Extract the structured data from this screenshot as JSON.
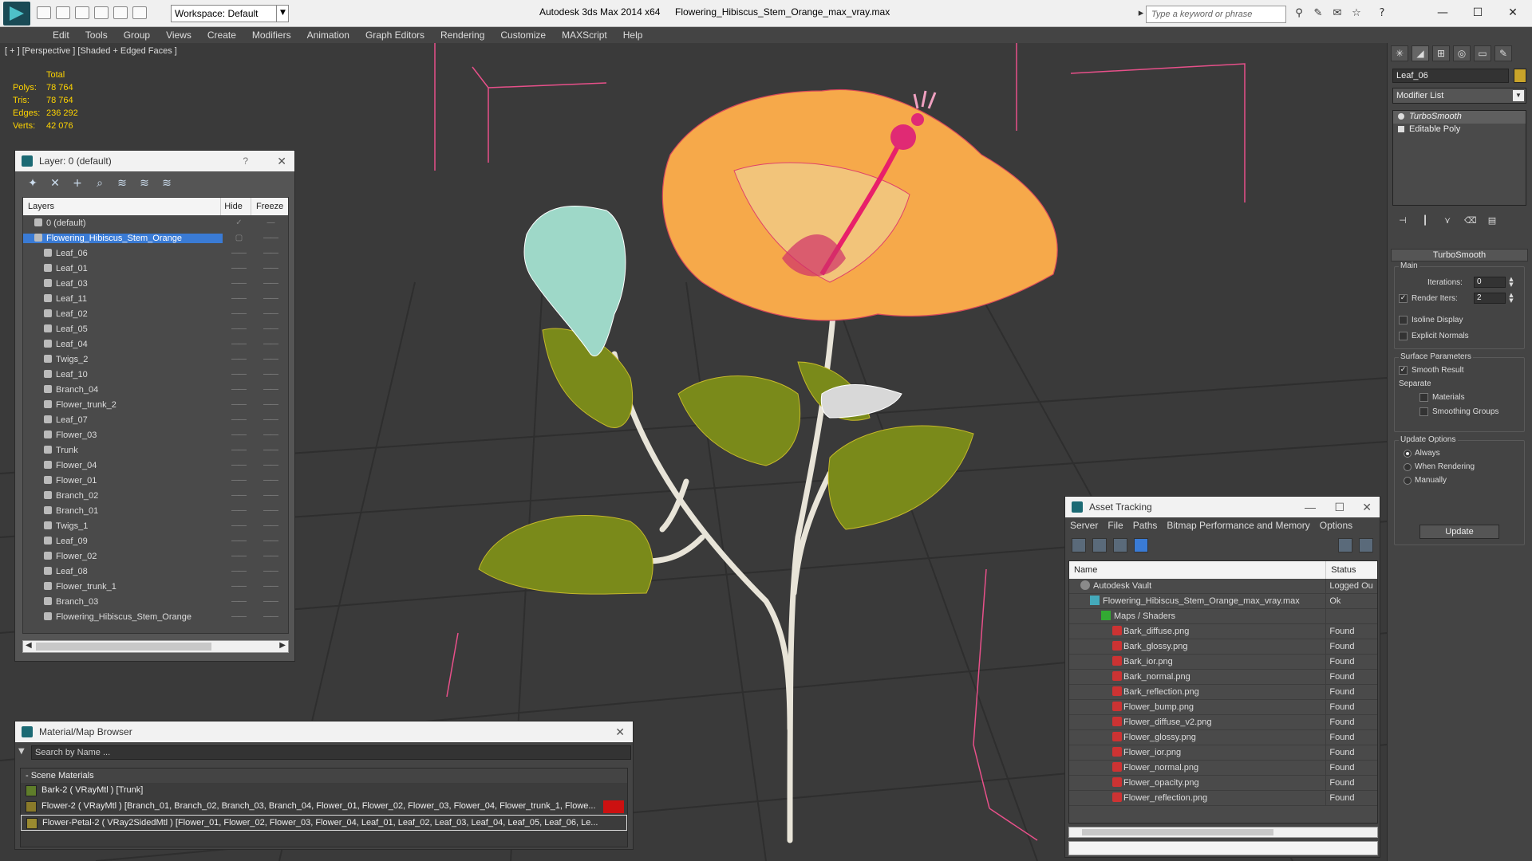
{
  "app": {
    "title": "Autodesk 3ds Max  2014 x64",
    "file": "Flowering_Hibiscus_Stem_Orange_max_vray.max",
    "workspace": "Workspace: Default",
    "search_placeholder": "Type a keyword or phrase"
  },
  "menu": [
    "Edit",
    "Tools",
    "Group",
    "Views",
    "Create",
    "Modifiers",
    "Animation",
    "Graph Editors",
    "Rendering",
    "Customize",
    "MAXScript",
    "Help"
  ],
  "viewport": {
    "label": "[ + ] [Perspective ] [Shaded + Edged Faces ]",
    "stats": {
      "header": "Total",
      "rows": [
        {
          "k": "Polys:",
          "v": "78 764"
        },
        {
          "k": "Tris:",
          "v": "78 764"
        },
        {
          "k": "Edges:",
          "v": "236 292"
        },
        {
          "k": "Verts:",
          "v": "42 076"
        }
      ]
    }
  },
  "layer_panel": {
    "title": "Layer: 0 (default)",
    "help": "?",
    "col_layers": "Layers",
    "col_hide": "Hide",
    "col_freeze": "Freeze",
    "rows": [
      {
        "name": "0 (default)",
        "indent": 1,
        "hide": "✓",
        "freeze": "—"
      },
      {
        "name": "Flowering_Hibiscus_Stem_Orange",
        "indent": 1,
        "selected": true,
        "hide": "▢",
        "freeze": "——"
      },
      {
        "name": "Leaf_06",
        "indent": 2,
        "hide": "——",
        "freeze": "——"
      },
      {
        "name": "Leaf_01",
        "indent": 2,
        "hide": "——",
        "freeze": "——"
      },
      {
        "name": "Leaf_03",
        "indent": 2,
        "hide": "——",
        "freeze": "——"
      },
      {
        "name": "Leaf_11",
        "indent": 2,
        "hide": "——",
        "freeze": "——"
      },
      {
        "name": "Leaf_02",
        "indent": 2,
        "hide": "——",
        "freeze": "——"
      },
      {
        "name": "Leaf_05",
        "indent": 2,
        "hide": "——",
        "freeze": "——"
      },
      {
        "name": "Leaf_04",
        "indent": 2,
        "hide": "——",
        "freeze": "——"
      },
      {
        "name": "Twigs_2",
        "indent": 2,
        "hide": "——",
        "freeze": "——"
      },
      {
        "name": "Leaf_10",
        "indent": 2,
        "hide": "——",
        "freeze": "——"
      },
      {
        "name": "Branch_04",
        "indent": 2,
        "hide": "——",
        "freeze": "——"
      },
      {
        "name": "Flower_trunk_2",
        "indent": 2,
        "hide": "——",
        "freeze": "——"
      },
      {
        "name": "Leaf_07",
        "indent": 2,
        "hide": "——",
        "freeze": "——"
      },
      {
        "name": "Flower_03",
        "indent": 2,
        "hide": "——",
        "freeze": "——"
      },
      {
        "name": "Trunk",
        "indent": 2,
        "hide": "——",
        "freeze": "——"
      },
      {
        "name": "Flower_04",
        "indent": 2,
        "hide": "——",
        "freeze": "——"
      },
      {
        "name": "Flower_01",
        "indent": 2,
        "hide": "——",
        "freeze": "——"
      },
      {
        "name": "Branch_02",
        "indent": 2,
        "hide": "——",
        "freeze": "——"
      },
      {
        "name": "Branch_01",
        "indent": 2,
        "hide": "——",
        "freeze": "——"
      },
      {
        "name": "Twigs_1",
        "indent": 2,
        "hide": "——",
        "freeze": "——"
      },
      {
        "name": "Leaf_09",
        "indent": 2,
        "hide": "——",
        "freeze": "——"
      },
      {
        "name": "Flower_02",
        "indent": 2,
        "hide": "——",
        "freeze": "——"
      },
      {
        "name": "Leaf_08",
        "indent": 2,
        "hide": "——",
        "freeze": "——"
      },
      {
        "name": "Flower_trunk_1",
        "indent": 2,
        "hide": "——",
        "freeze": "——"
      },
      {
        "name": "Branch_03",
        "indent": 2,
        "hide": "——",
        "freeze": "——"
      },
      {
        "name": "Flowering_Hibiscus_Stem_Orange",
        "indent": 2,
        "hide": "——",
        "freeze": "——"
      }
    ]
  },
  "material_browser": {
    "title": "Material/Map Browser",
    "search_placeholder": "Search by Name ...",
    "group": "- Scene Materials",
    "rows": [
      {
        "text": "Bark-2  ( VRayMtl ) [Trunk]",
        "color": "#5f7d2a"
      },
      {
        "text": "Flower-2  ( VRayMtl )  [Branch_01, Branch_02, Branch_03, Branch_04, Flower_01, Flower_02, Flower_03, Flower_04, Flower_trunk_1, Flowe...",
        "color": "#8a7a2a",
        "flag": true
      },
      {
        "text": "Flower-Petal-2  ( VRay2SidedMtl )  [Flower_01, Flower_02, Flower_03, Flower_04, Leaf_01, Leaf_02, Leaf_03, Leaf_04, Leaf_05, Leaf_06, Le...",
        "color": "#9a8a30",
        "selected": true
      }
    ]
  },
  "asset_tracking": {
    "title": "Asset Tracking",
    "menu": [
      "Server",
      "File",
      "Paths",
      "Bitmap Performance and Memory",
      "Options"
    ],
    "col_name": "Name",
    "col_status": "Status",
    "rows": [
      {
        "name": "Autodesk Vault",
        "status": "Logged Ou",
        "kind": "vault"
      },
      {
        "name": "Flowering_Hibiscus_Stem_Orange_max_vray.max",
        "status": "Ok",
        "kind": "max"
      },
      {
        "name": "Maps / Shaders",
        "status": "",
        "kind": "map"
      },
      {
        "name": "Bark_diffuse.png",
        "status": "Found",
        "kind": "png"
      },
      {
        "name": "Bark_glossy.png",
        "status": "Found",
        "kind": "png"
      },
      {
        "name": "Bark_ior.png",
        "status": "Found",
        "kind": "png"
      },
      {
        "name": "Bark_normal.png",
        "status": "Found",
        "kind": "png"
      },
      {
        "name": "Bark_reflection.png",
        "status": "Found",
        "kind": "png"
      },
      {
        "name": "Flower_bump.png",
        "status": "Found",
        "kind": "png"
      },
      {
        "name": "Flower_diffuse_v2.png",
        "status": "Found",
        "kind": "png"
      },
      {
        "name": "Flower_glossy.png",
        "status": "Found",
        "kind": "png"
      },
      {
        "name": "Flower_ior.png",
        "status": "Found",
        "kind": "png"
      },
      {
        "name": "Flower_normal.png",
        "status": "Found",
        "kind": "png"
      },
      {
        "name": "Flower_opacity.png",
        "status": "Found",
        "kind": "png"
      },
      {
        "name": "Flower_reflection.png",
        "status": "Found",
        "kind": "png"
      }
    ]
  },
  "command_panel": {
    "object_name": "Leaf_06",
    "object_color": "#c9a42a",
    "modifier_list": "Modifier List",
    "stack": [
      {
        "name": "TurboSmooth",
        "selected": true
      },
      {
        "name": "Editable Poly",
        "selected": false
      }
    ],
    "rollout": "TurboSmooth",
    "main_label": "Main",
    "iterations_label": "Iterations:",
    "iterations_value": "0",
    "render_iters_label": "Render Iters:",
    "render_iters_value": "2",
    "isoline": "Isoline Display",
    "explicit": "Explicit Normals",
    "surface_params": "Surface Parameters",
    "smooth_result": "Smooth Result",
    "separate": "Separate",
    "materials": "Materials",
    "smoothing_groups": "Smoothing Groups",
    "update_options": "Update Options",
    "always": "Always",
    "when_rendering": "When Rendering",
    "manually": "Manually",
    "update_btn": "Update"
  }
}
